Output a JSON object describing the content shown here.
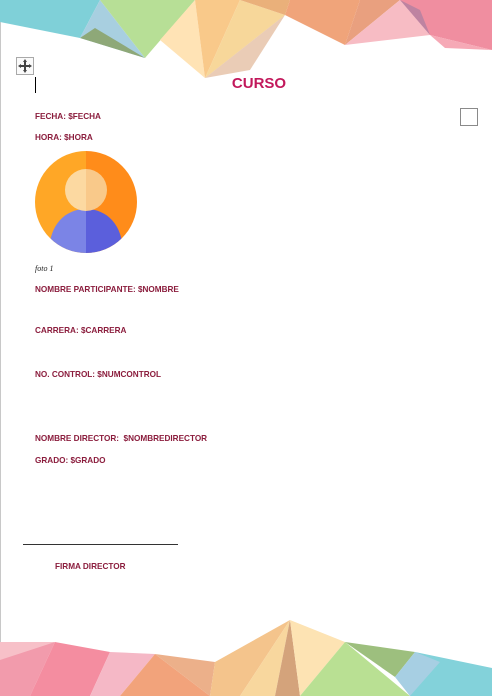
{
  "document": {
    "title": "CURSO",
    "fields": {
      "fecha": "FECHA: $FECHA",
      "hora": "HORA: $HORA",
      "nombre_participante": "NOMBRE PARTICIPANTE: $NOMBRE",
      "carrera": "CARRERA: $CARRERA",
      "no_control": "NO. CONTROL: $NUMCONTROL",
      "nombre_director": "NOMBRE DIRECTOR:  $NOMBREDIRECTOR",
      "grado": "GRADO: $GRADO"
    },
    "photo_caption": "foto 1",
    "signature_label": "FIRMA DIRECTOR"
  },
  "icons": {
    "table_move_handle": "move-arrows-icon",
    "content_control": "checkbox-icon",
    "photo": "user-avatar-icon"
  },
  "colors": {
    "title": "#c2185b",
    "field_text": "#8b1d3d",
    "avatar_orange": "#ff8c1a",
    "avatar_blue": "#5b5fdc"
  }
}
